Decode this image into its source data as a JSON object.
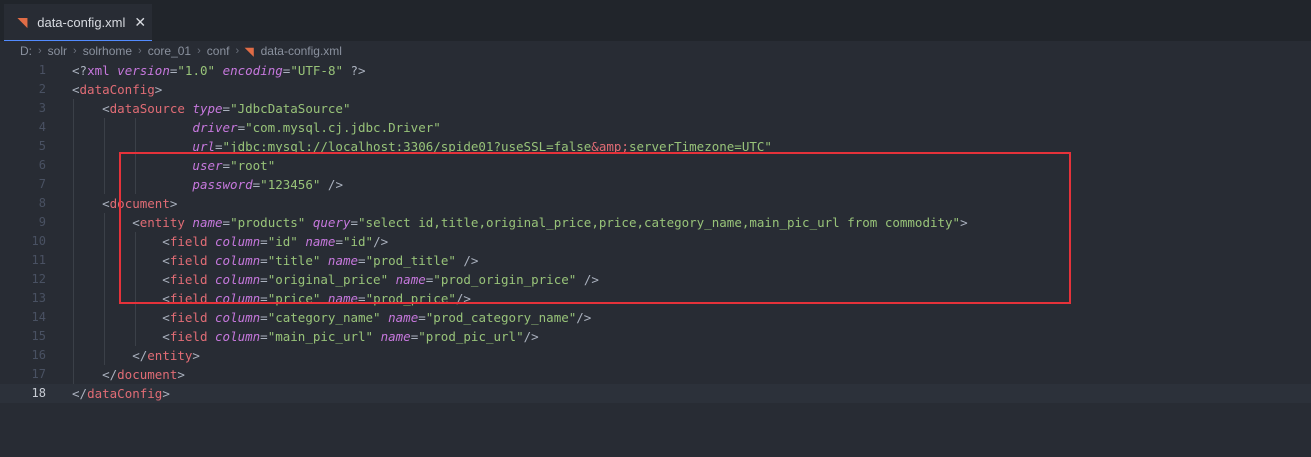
{
  "tab": {
    "icon": "rss-icon",
    "label": "data-config.xml",
    "close": "✕"
  },
  "breadcrumb": [
    "D:",
    "solr",
    "solrhome",
    "core_01",
    "conf",
    "data-config.xml"
  ],
  "editor": {
    "active_line": 18,
    "lines": [
      {
        "n": "1",
        "tokens": [
          [
            "p",
            "<?"
          ],
          [
            "pi",
            "xml"
          ],
          [
            "p",
            " "
          ],
          [
            "a",
            "version"
          ],
          [
            "p",
            "="
          ],
          [
            "s",
            "\"1.0\""
          ],
          [
            "p",
            " "
          ],
          [
            "a",
            "encoding"
          ],
          [
            "p",
            "="
          ],
          [
            "s",
            "\"UTF-8\""
          ],
          [
            "p",
            " ?>"
          ]
        ]
      },
      {
        "n": "2",
        "tokens": [
          [
            "p",
            "<"
          ],
          [
            "t",
            "dataConfig"
          ],
          [
            "p",
            ">"
          ]
        ]
      },
      {
        "n": "3",
        "tokens": [
          [
            "p",
            "    <"
          ],
          [
            "t",
            "dataSource"
          ],
          [
            "p",
            " "
          ],
          [
            "a",
            "type"
          ],
          [
            "p",
            "="
          ],
          [
            "s",
            "\"JdbcDataSource\""
          ]
        ]
      },
      {
        "n": "4",
        "tokens": [
          [
            "p",
            "                "
          ],
          [
            "a",
            "driver"
          ],
          [
            "p",
            "="
          ],
          [
            "s",
            "\"com.mysql.cj.jdbc.Driver\""
          ]
        ]
      },
      {
        "n": "5",
        "tokens": [
          [
            "p",
            "                "
          ],
          [
            "a",
            "url"
          ],
          [
            "p",
            "="
          ],
          [
            "s",
            "\"jdbc:mysql://localhost:3306/spide01?useSSL=false"
          ],
          [
            "e",
            "&amp;"
          ],
          [
            "s",
            "serverTimezone=UTC\""
          ]
        ]
      },
      {
        "n": "6",
        "tokens": [
          [
            "p",
            "                "
          ],
          [
            "a",
            "user"
          ],
          [
            "p",
            "="
          ],
          [
            "s",
            "\"root\""
          ]
        ]
      },
      {
        "n": "7",
        "tokens": [
          [
            "p",
            "                "
          ],
          [
            "a",
            "password"
          ],
          [
            "p",
            "="
          ],
          [
            "s",
            "\"123456\""
          ],
          [
            "p",
            " />"
          ]
        ]
      },
      {
        "n": "8",
        "tokens": [
          [
            "p",
            "    <"
          ],
          [
            "t",
            "document"
          ],
          [
            "p",
            ">"
          ]
        ]
      },
      {
        "n": "9",
        "tokens": [
          [
            "p",
            "        <"
          ],
          [
            "t",
            "entity"
          ],
          [
            "p",
            " "
          ],
          [
            "a",
            "name"
          ],
          [
            "p",
            "="
          ],
          [
            "s",
            "\"products\""
          ],
          [
            "p",
            " "
          ],
          [
            "a",
            "query"
          ],
          [
            "p",
            "="
          ],
          [
            "s",
            "\"select id,title,original_price,price,category_name,main_pic_url from commodity\""
          ],
          [
            "p",
            ">"
          ]
        ]
      },
      {
        "n": "10",
        "tokens": [
          [
            "p",
            "            <"
          ],
          [
            "t",
            "field"
          ],
          [
            "p",
            " "
          ],
          [
            "a",
            "column"
          ],
          [
            "p",
            "="
          ],
          [
            "s",
            "\"id\""
          ],
          [
            "p",
            " "
          ],
          [
            "a",
            "name"
          ],
          [
            "p",
            "="
          ],
          [
            "s",
            "\"id\""
          ],
          [
            "p",
            "/>"
          ]
        ]
      },
      {
        "n": "11",
        "tokens": [
          [
            "p",
            "            <"
          ],
          [
            "t",
            "field"
          ],
          [
            "p",
            " "
          ],
          [
            "a",
            "column"
          ],
          [
            "p",
            "="
          ],
          [
            "s",
            "\"title\""
          ],
          [
            "p",
            " "
          ],
          [
            "a",
            "name"
          ],
          [
            "p",
            "="
          ],
          [
            "s",
            "\"prod_title\""
          ],
          [
            "p",
            " />"
          ]
        ]
      },
      {
        "n": "12",
        "tokens": [
          [
            "p",
            "            <"
          ],
          [
            "t",
            "field"
          ],
          [
            "p",
            " "
          ],
          [
            "a",
            "column"
          ],
          [
            "p",
            "="
          ],
          [
            "s",
            "\"original_price\""
          ],
          [
            "p",
            " "
          ],
          [
            "a",
            "name"
          ],
          [
            "p",
            "="
          ],
          [
            "s",
            "\"prod_origin_price\""
          ],
          [
            "p",
            " />"
          ]
        ]
      },
      {
        "n": "13",
        "tokens": [
          [
            "p",
            "            <"
          ],
          [
            "t",
            "field"
          ],
          [
            "p",
            " "
          ],
          [
            "a",
            "column"
          ],
          [
            "p",
            "="
          ],
          [
            "s",
            "\"price\""
          ],
          [
            "p",
            " "
          ],
          [
            "a",
            "name"
          ],
          [
            "p",
            "="
          ],
          [
            "s",
            "\"prod_price\""
          ],
          [
            "p",
            "/>"
          ]
        ]
      },
      {
        "n": "14",
        "tokens": [
          [
            "p",
            "            <"
          ],
          [
            "t",
            "field"
          ],
          [
            "p",
            " "
          ],
          [
            "a",
            "column"
          ],
          [
            "p",
            "="
          ],
          [
            "s",
            "\"category_name\""
          ],
          [
            "p",
            " "
          ],
          [
            "a",
            "name"
          ],
          [
            "p",
            "="
          ],
          [
            "s",
            "\"prod_category_name\""
          ],
          [
            "p",
            "/>"
          ]
        ]
      },
      {
        "n": "15",
        "tokens": [
          [
            "p",
            "            <"
          ],
          [
            "t",
            "field"
          ],
          [
            "p",
            " "
          ],
          [
            "a",
            "column"
          ],
          [
            "p",
            "="
          ],
          [
            "s",
            "\"main_pic_url\""
          ],
          [
            "p",
            " "
          ],
          [
            "a",
            "name"
          ],
          [
            "p",
            "="
          ],
          [
            "s",
            "\"prod_pic_url\""
          ],
          [
            "p",
            "/>"
          ]
        ]
      },
      {
        "n": "16",
        "tokens": [
          [
            "p",
            "        </"
          ],
          [
            "t",
            "entity"
          ],
          [
            "p",
            ">"
          ]
        ]
      },
      {
        "n": "17",
        "tokens": [
          [
            "p",
            "    </"
          ],
          [
            "t",
            "document"
          ],
          [
            "p",
            ">"
          ]
        ]
      },
      {
        "n": "18",
        "tokens": [
          [
            "p",
            "</"
          ],
          [
            "t",
            "dataConfig"
          ],
          [
            "p",
            ">"
          ]
        ]
      }
    ]
  },
  "annotation": {
    "color": "#e5323a",
    "covers_lines": [
      9,
      16
    ]
  },
  "colors": {
    "background": "#282c34",
    "tag": "#e06c75",
    "attribute": "#c678dd",
    "string": "#98c379",
    "punctuation": "#abb2bf",
    "tab_accent": "#528bff"
  }
}
